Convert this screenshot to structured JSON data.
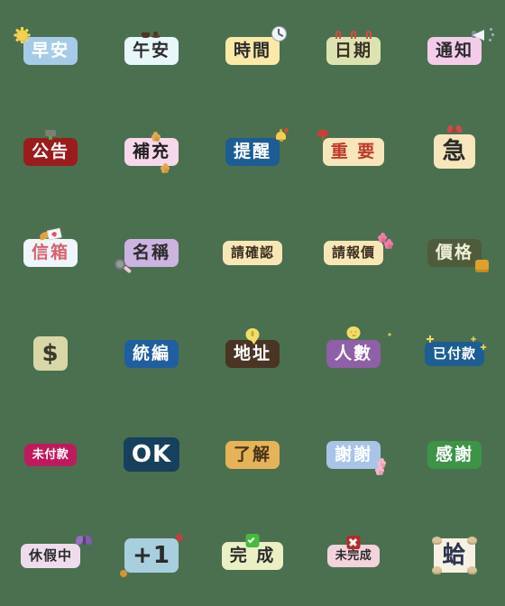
{
  "page": {
    "title": "Chinese Work Label Emoji Sticker Set",
    "background_color": "#4b7050",
    "columns": 5,
    "rows": 6,
    "total_stickers": 30
  },
  "stickers": [
    {
      "id": "zao-an",
      "label": "早安",
      "bg": "#a6cbe8",
      "fg": "#ffffff",
      "size": "normal",
      "decoration": "sun-icon"
    },
    {
      "id": "wu-an",
      "label": "午安",
      "bg": "#e8f7f9",
      "fg": "#2b2b2b",
      "size": "normal",
      "decoration": "coffee-icon"
    },
    {
      "id": "shi-jian",
      "label": "時間",
      "bg": "#fbe9a8",
      "fg": "#2b2b2b",
      "size": "normal",
      "decoration": "clock-icon"
    },
    {
      "id": "ri-qi",
      "label": "日期",
      "bg": "#dde3b0",
      "fg": "#3a3226",
      "size": "normal",
      "decoration": "calendar-rings-icon"
    },
    {
      "id": "tong-zhi",
      "label": "通知",
      "bg": "#f3ccea",
      "fg": "#2b2b2b",
      "size": "normal",
      "decoration": "megaphone-icon"
    },
    {
      "id": "gong-gao",
      "label": "公告",
      "bg": "#9b1c1c",
      "fg": "#ffffff",
      "size": "normal",
      "decoration": "pin-icon"
    },
    {
      "id": "bu-chong",
      "label": "補充",
      "bg": "#f7d7ec",
      "fg": "#1f1f1f",
      "size": "normal",
      "decoration": "flowers-orange-icon"
    },
    {
      "id": "ti-xing",
      "label": "提醒",
      "bg": "#1d5c94",
      "fg": "#ffffff",
      "size": "normal",
      "decoration": "bell-icon"
    },
    {
      "id": "zhong-yao",
      "label": "重 要",
      "bg": "#f7e6bb",
      "fg": "#c0392b",
      "size": "normal",
      "decoration": "exclaim-icon"
    },
    {
      "id": "ji",
      "label": "急",
      "bg": "#f7e6bb",
      "fg": "#2b2b2b",
      "size": "big",
      "decoration": "bow-icon"
    },
    {
      "id": "xin-xiang",
      "label": "信箱",
      "bg": "#eef6fb",
      "fg": "#d9616e",
      "size": "normal",
      "decoration": "mail-icon"
    },
    {
      "id": "ming-cheng",
      "label": "名稱",
      "bg": "#cdb3e0",
      "fg": "#2b2b2b",
      "size": "normal",
      "decoration": "magnifier-icon"
    },
    {
      "id": "qing-que-ren",
      "label": "請確認",
      "bg": "#f8e7b6",
      "fg": "#3a2f20",
      "size": "small",
      "decoration": "none"
    },
    {
      "id": "qing-bao-jia",
      "label": "請報價",
      "bg": "#f8e7b6",
      "fg": "#3a2f20",
      "size": "small",
      "decoration": "flowers-pink-icon"
    },
    {
      "id": "jia-ge",
      "label": "價格",
      "bg": "#4e5c3c",
      "fg": "#f2efd9",
      "size": "normal",
      "decoration": "eraser-icon"
    },
    {
      "id": "dollar",
      "label": "$",
      "bg": "#d9d7a8",
      "fg": "#3a3a2a",
      "size": "big",
      "decoration": "none"
    },
    {
      "id": "tong-bian",
      "label": "統編",
      "bg": "#1f5ea0",
      "fg": "#ffffff",
      "size": "normal",
      "decoration": "none"
    },
    {
      "id": "di-zhi",
      "label": "地址",
      "bg": "#4a3423",
      "fg": "#ffffff",
      "size": "normal",
      "decoration": "balloon-pin-icon"
    },
    {
      "id": "ren-shu",
      "label": "人數",
      "bg": "#8f5fa8",
      "fg": "#ffffff",
      "size": "normal",
      "decoration": "balloon-face-icon"
    },
    {
      "id": "yi-fu-kuan",
      "label": "已付款",
      "bg": "#1c5e93",
      "fg": "#ffffff",
      "size": "small",
      "decoration": "sparkles-icon"
    },
    {
      "id": "wei-fu-kuan",
      "label": "未付款",
      "bg": "#bf1a5e",
      "fg": "#ffffff",
      "size": "tiny",
      "decoration": "none"
    },
    {
      "id": "ok",
      "label": "OK",
      "bg": "#17405e",
      "fg": "#ffffff",
      "size": "big",
      "decoration": "none"
    },
    {
      "id": "liao-jie",
      "label": "了解",
      "bg": "#e6b35a",
      "fg": "#4a3415",
      "size": "normal",
      "decoration": "none"
    },
    {
      "id": "xie-xie",
      "label": "謝謝",
      "bg": "#a8c5e8",
      "fg": "#ffffff",
      "size": "normal",
      "decoration": "flowers-pink-side-icon"
    },
    {
      "id": "gan-xie",
      "label": "感謝",
      "bg": "#3d9447",
      "fg": "#ffffff",
      "size": "normal",
      "decoration": "none"
    },
    {
      "id": "xiu-jia-zhong",
      "label": "休假中",
      "bg": "#eedcec",
      "fg": "#2b2b2b",
      "size": "small",
      "decoration": "butterfly-icon"
    },
    {
      "id": "plus-one",
      "label": "+1",
      "bg": "#a8cfdd",
      "fg": "#2b2b2b",
      "size": "big",
      "decoration": "dots-icon"
    },
    {
      "id": "wan-cheng",
      "label": "完 成",
      "bg": "#eaf0c4",
      "fg": "#2b2b2b",
      "size": "normal",
      "decoration": "check-badge-icon"
    },
    {
      "id": "wei-wan-cheng",
      "label": "未完成",
      "bg": "#f3d3dc",
      "fg": "#2b2b2b",
      "size": "tiny",
      "decoration": "cross-badge-icon"
    },
    {
      "id": "ge",
      "label": "蛤",
      "bg": "#f7f0e4",
      "fg": "#2b3550",
      "size": "big",
      "decoration": "shells-icon"
    }
  ]
}
